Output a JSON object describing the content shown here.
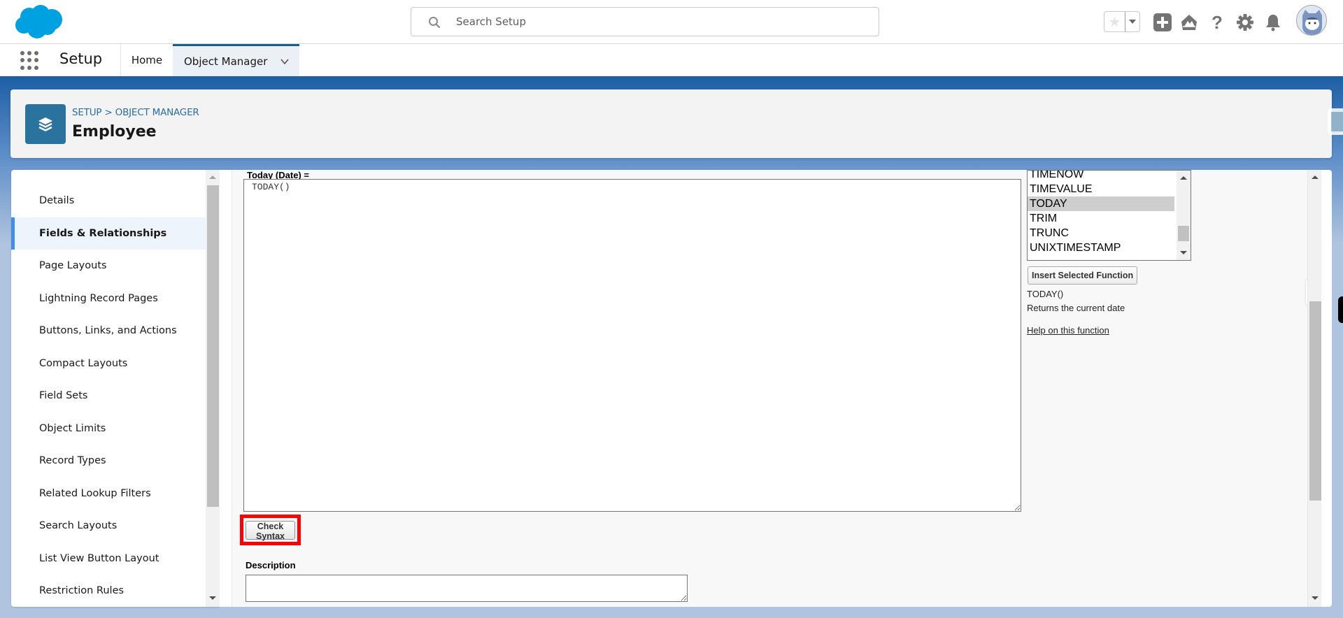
{
  "header": {
    "search_placeholder": "Search Setup",
    "icons": [
      "favorites-star-icon",
      "favorites-dropdown-icon",
      "global-add-icon",
      "trailhead-icon",
      "help-icon",
      "setup-gear-icon",
      "notifications-bell-icon",
      "user-avatar"
    ]
  },
  "nav": {
    "app_name": "Setup",
    "tabs": [
      {
        "label": "Home",
        "active": false
      },
      {
        "label": "Object Manager",
        "active": true
      }
    ]
  },
  "page_header": {
    "breadcrumb": "SETUP > OBJECT MANAGER",
    "title": "Employee",
    "icon": "layers-icon"
  },
  "sidebar": {
    "items": [
      {
        "label": "Details",
        "active": false
      },
      {
        "label": "Fields & Relationships",
        "active": true
      },
      {
        "label": "Page Layouts",
        "active": false
      },
      {
        "label": "Lightning Record Pages",
        "active": false
      },
      {
        "label": "Buttons, Links, and Actions",
        "active": false
      },
      {
        "label": "Compact Layouts",
        "active": false
      },
      {
        "label": "Field Sets",
        "active": false
      },
      {
        "label": "Object Limits",
        "active": false
      },
      {
        "label": "Record Types",
        "active": false
      },
      {
        "label": "Related Lookup Filters",
        "active": false
      },
      {
        "label": "Search Layouts",
        "active": false
      },
      {
        "label": "List View Button Layout",
        "active": false
      },
      {
        "label": "Restriction Rules",
        "active": false
      }
    ]
  },
  "formula_editor": {
    "label": "Today (Date) =",
    "formula_value": "TODAY()",
    "functions": [
      "TIMENOW",
      "TIMEVALUE",
      "TODAY",
      "TRIM",
      "TRUNC",
      "UNIXTIMESTAMP"
    ],
    "selected_function": "TODAY",
    "insert_button_label": "Insert Selected Function",
    "function_signature": "TODAY()",
    "function_description": "Returns the current date",
    "help_link_label": "Help on this function",
    "check_syntax_label": "Check Syntax"
  },
  "description": {
    "label": "Description",
    "value": ""
  },
  "colors": {
    "brand_blue": "#00a1e0",
    "active_tab_border": "#1b5f8c",
    "sidebar_active_bar": "#3f8ef0",
    "highlight_box": "#ff0000",
    "object_icon_bg": "#2a739e",
    "breadcrumb_link": "#2a6ea3"
  }
}
